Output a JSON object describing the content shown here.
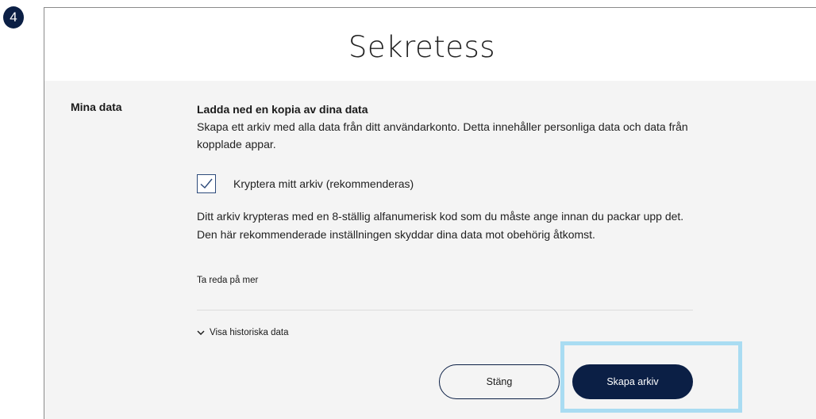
{
  "step_number": "4",
  "dialog": {
    "title": "Sekretess",
    "section_label": "Mina data",
    "heading": "Ladda ned en kopia av dina data",
    "description": "Skapa ett arkiv med alla data från ditt användarkonto. Detta innehåller personliga data och data från kopplade appar.",
    "encrypt_checkbox": {
      "label": "Kryptera mitt arkiv (rekommenderas)",
      "checked": true
    },
    "encrypt_explanation": "Ditt arkiv krypteras med en 8-ställig alfanumerisk kod som du måste ange innan du packar upp det. Den här rekommenderade inställningen skyddar dina data mot obehörig åtkomst.",
    "learn_more_link": "Ta reda på mer",
    "history_toggle": "Visa historiska data",
    "close_button": "Stäng",
    "create_button": "Skapa arkiv"
  },
  "colors": {
    "primary": "#0b1f45",
    "background": "#f4f4f4",
    "highlight": "#a9dcf2"
  },
  "icons": {
    "checkbox": "checkmark-icon",
    "history_toggle": "chevron-down-icon"
  }
}
